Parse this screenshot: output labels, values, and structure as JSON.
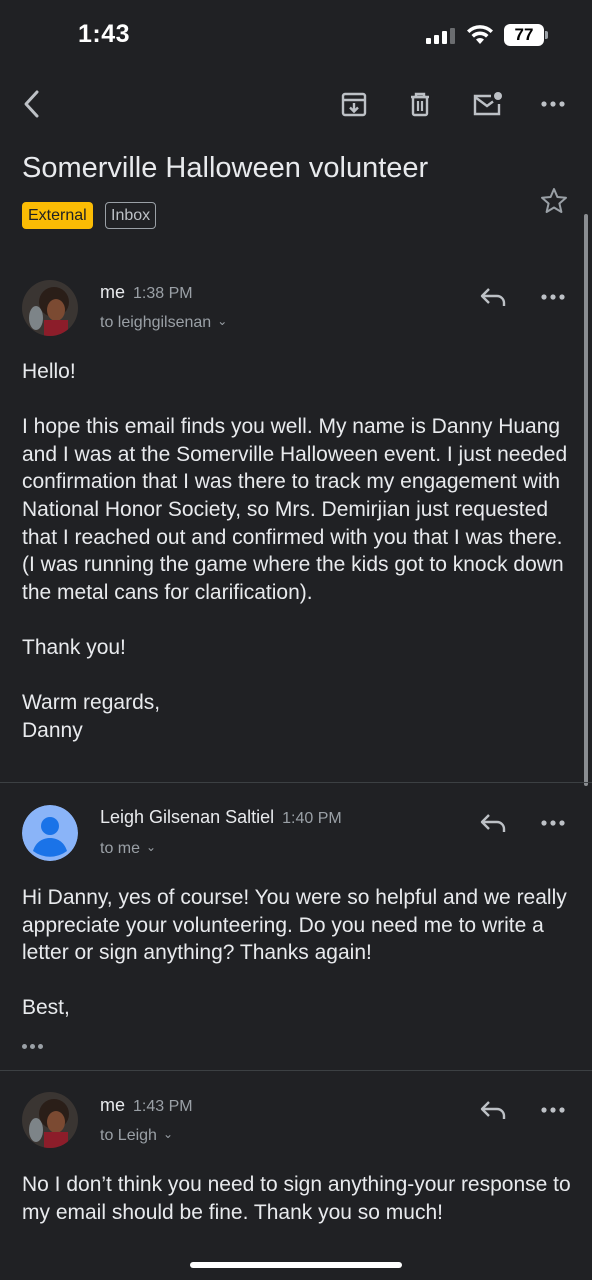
{
  "status_bar": {
    "time": "1:43",
    "battery": "77"
  },
  "toolbar": {
    "back_icon": "back-arrow-icon",
    "archive_icon": "archive-icon",
    "delete_icon": "trash-icon",
    "unread_icon": "mark-unread-icon",
    "more_icon": "more-horizontal-icon"
  },
  "thread": {
    "subject": "Somerville Halloween volunteer",
    "labels": [
      "External",
      "Inbox"
    ],
    "star_icon": "star-outline-icon"
  },
  "messages": [
    {
      "sender": "me",
      "time": "1:38 PM",
      "recipient": "to leighgilsenan",
      "body": [
        "Hello!",
        "",
        "I hope this email finds you well. My name is Danny Huang and I was at the Somerville Halloween event. I just needed confirmation that I was there to track my engagement with National Honor Society, so Mrs. Demirjian just requested that I reached out and confirmed with you that I was there. (I was running the game where the kids got to knock down the metal cans for clarification).",
        "",
        "Thank you!",
        "",
        "Warm regards,",
        "Danny"
      ]
    },
    {
      "sender": "Leigh Gilsenan Saltiel",
      "time": "1:40 PM",
      "recipient": "to me",
      "body": [
        "Hi Danny, yes of course! You were so helpful and we really appreciate your volunteering. Do you need me to write a letter or sign anything? Thanks again!",
        "",
        "Best,"
      ]
    },
    {
      "sender": "me",
      "time": "1:43 PM",
      "recipient": "to Leigh",
      "body": [
        "No I don’t think you need to sign anything-your response to my email should be fine. Thank you so much!"
      ]
    }
  ],
  "colors": {
    "background": "#202124",
    "external_label": "#fbbc04",
    "default_avatar": "#8ab4f8"
  }
}
